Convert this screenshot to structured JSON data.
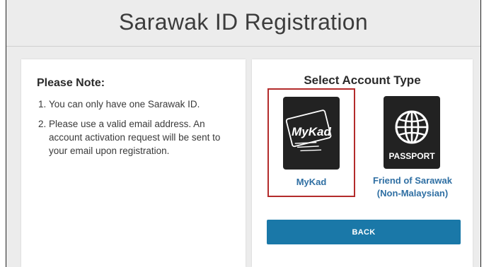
{
  "page": {
    "title": "Sarawak ID Registration"
  },
  "note_panel": {
    "heading": "Please Note:",
    "items": [
      {
        "number": "1.",
        "text": "You can only have one Sarawak ID."
      },
      {
        "number": "2.",
        "text": "Please use a valid email address. An account activation request will be sent to your email upon registration."
      }
    ]
  },
  "account_panel": {
    "heading": "Select Account Type",
    "options": [
      {
        "icon": "mykad-card-icon",
        "icon_text": "MyKad",
        "label": "MyKad",
        "selected": true
      },
      {
        "icon": "globe-passport-icon",
        "icon_text": "PASSPORT",
        "label_line1": "Friend of Sarawak",
        "label_line2": "(Non-Malaysian)",
        "selected": false
      }
    ],
    "back_label": "BACK"
  },
  "colors": {
    "background": "#ececec",
    "panel": "#ffffff",
    "link_blue": "#2f6fa3",
    "button_blue": "#1a78a8",
    "selected_border": "#b32b2b",
    "icon_dark": "#222222"
  }
}
